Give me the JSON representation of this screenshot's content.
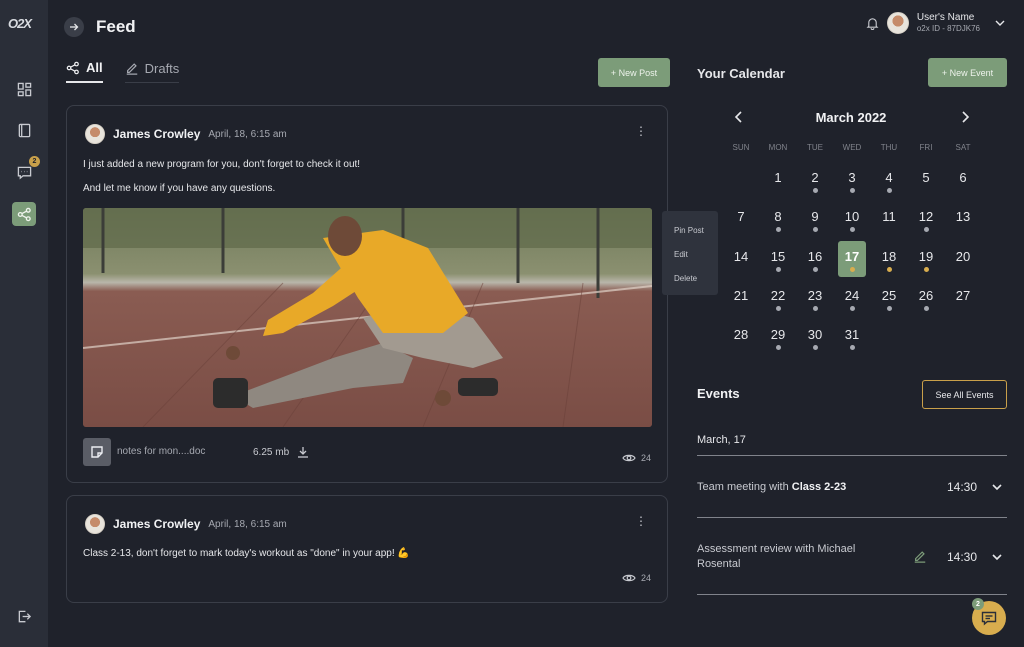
{
  "sidebar": {
    "logo": "O2X",
    "chat_badge": "2",
    "icons": [
      "dashboard-icon",
      "book-icon",
      "chat-icon",
      "share-icon",
      "logout-icon"
    ]
  },
  "header": {
    "title": "Feed",
    "user_name": "User's Name",
    "user_id": "o2x ID - 87DJK76"
  },
  "tabs": [
    {
      "label": "All",
      "active": true
    },
    {
      "label": "Drafts",
      "active": false
    }
  ],
  "new_post_label": "+ New Post",
  "posts": [
    {
      "author": "James Crowley",
      "date": "April, 18, 6:15 am",
      "lines": [
        "I just added a new program for you, don't forget to check it out!",
        "And let me know if you have any questions."
      ],
      "attachment": {
        "name": "notes for mon....doc",
        "size": "6.25 mb"
      },
      "views": "24"
    },
    {
      "author": "James Crowley",
      "date": "April, 18, 6:15 am",
      "lines": [
        "Class 2-13, don't forget to mark today's workout as \"done\" in your app! 💪"
      ],
      "views": "24"
    }
  ],
  "context_menu": [
    "Pin Post",
    "Edit",
    "Delete"
  ],
  "calendar": {
    "title": "Your Calendar",
    "new_event_label": "+ New Event",
    "month": "March 2022",
    "dow": [
      "SUN",
      "MON",
      "TUE",
      "WED",
      "THU",
      "FRI",
      "SAT"
    ],
    "selected_day": 17,
    "weeks": [
      [
        null,
        null,
        1,
        2,
        3,
        4,
        5,
        6
      ],
      [
        7,
        8,
        9,
        10,
        11,
        12,
        13
      ],
      [
        14,
        15,
        16,
        17,
        18,
        19,
        20
      ],
      [
        21,
        22,
        23,
        24,
        25,
        26,
        27
      ],
      [
        28,
        29,
        30,
        31,
        null,
        null,
        null
      ]
    ]
  },
  "events": {
    "title": "Events",
    "see_all_label": "See All Events",
    "date": "March, 17",
    "items": [
      {
        "prefix": "Team meeting with ",
        "bold": "Class 2-23",
        "time": "14:30"
      },
      {
        "prefix": "Assessment review with Michael Rosental",
        "bold": "",
        "time": "14:30"
      }
    ]
  },
  "chat_fab_badge": "2"
}
